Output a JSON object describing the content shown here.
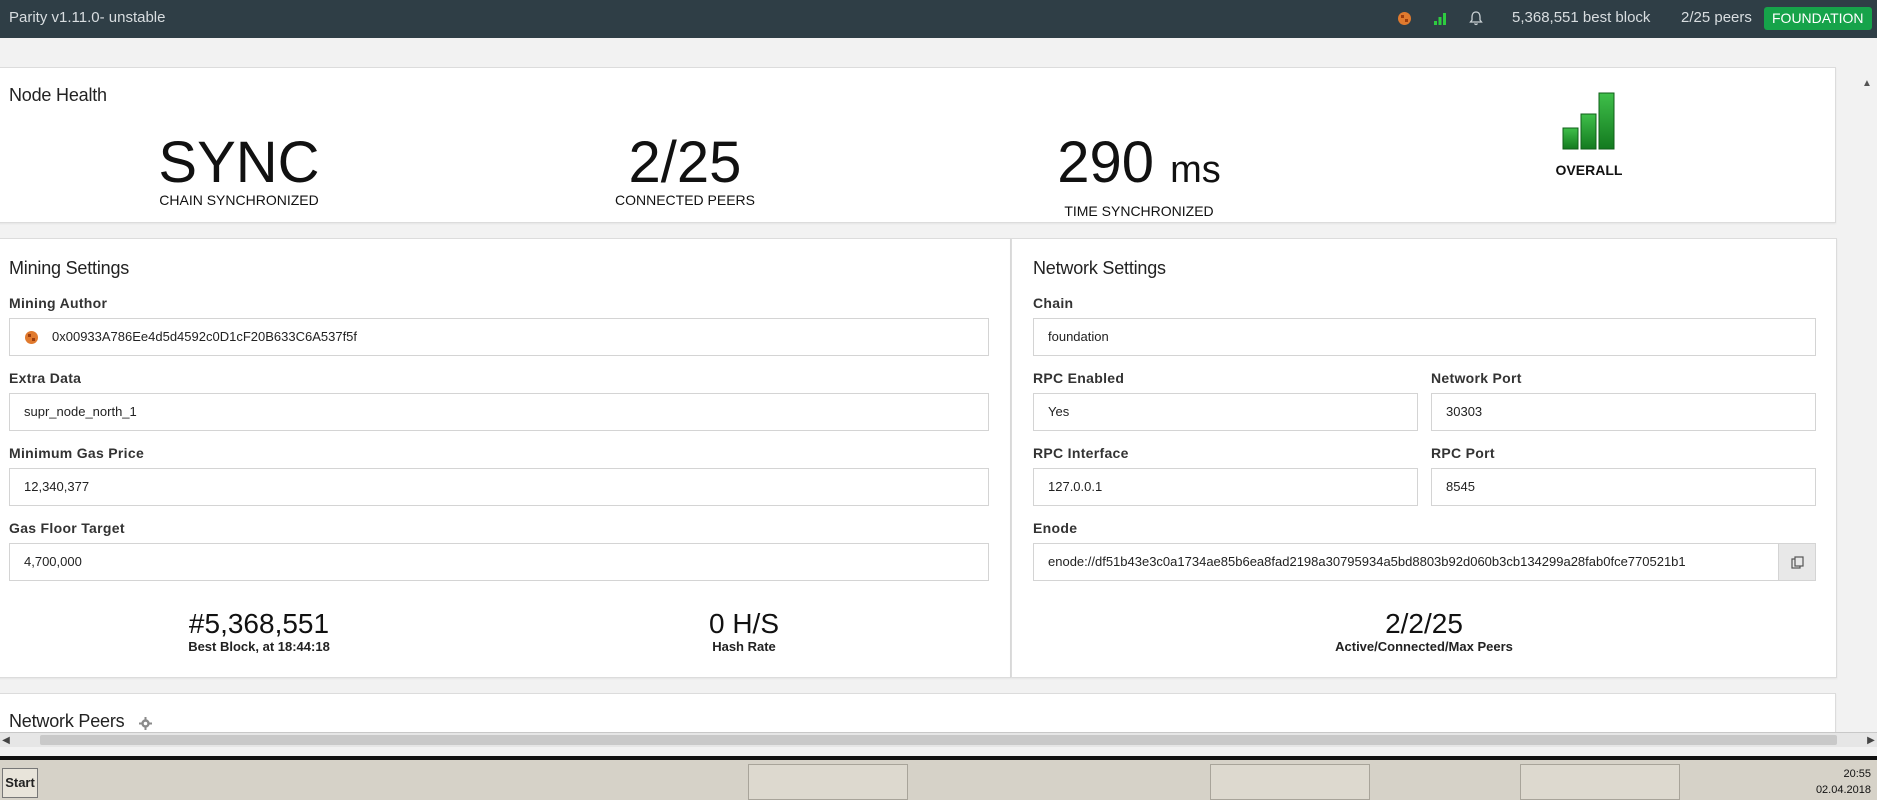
{
  "topbar": {
    "title": "Parity v1.11.0- unstable",
    "best_block": "5,368,551 best block",
    "peers": "2/25 peers",
    "chain_badge": "FOUNDATION",
    "icons": [
      "identicon",
      "signal-bars-icon",
      "bell-icon"
    ],
    "badge_color": "#16a34a"
  },
  "health": {
    "title": "Node Health",
    "sync_value": "SYNC",
    "sync_caption": "CHAIN SYNCHRONIZED",
    "peers_value": "2/25",
    "peers_caption": "CONNECTED PEERS",
    "time_value": "290",
    "time_unit": "ms",
    "time_caption": "TIME SYNCHRONIZED",
    "overall_caption": "OVERALL",
    "overall_color": "#1e9e2e"
  },
  "mining": {
    "title": "Mining Settings",
    "author_label": "Mining Author",
    "author_value": "0x00933A786Ee4d5d4592c0D1cF20B633C6A537f5f",
    "extra_label": "Extra Data",
    "extra_value": "supr_node_north_1",
    "gas_price_label": "Minimum Gas Price",
    "gas_price_value": "12,340,377",
    "gas_floor_label": "Gas Floor Target",
    "gas_floor_value": "4,700,000",
    "best_block_value": "#5,368,551",
    "best_block_label": "Best Block, at 18:44:18",
    "hash_rate_value": "0 H/S",
    "hash_rate_label": "Hash Rate"
  },
  "network": {
    "title": "Network Settings",
    "chain_label": "Chain",
    "chain_value": "foundation",
    "rpc_enabled_label": "RPC Enabled",
    "rpc_enabled_value": "Yes",
    "network_port_label": "Network Port",
    "network_port_value": "30303",
    "rpc_interface_label": "RPC Interface",
    "rpc_interface_value": "127.0.0.1",
    "rpc_port_label": "RPC Port",
    "rpc_port_value": "8545",
    "enode_label": "Enode",
    "enode_value": "enode://df51b43e3c0a1734ae85b6ea8fad2198a30795934a5bd8803b92d060b3cb134299a28fab0fce770521b1",
    "peers_value": "2/2/25",
    "peers_label": "Active/Connected/Max Peers"
  },
  "peers_section": {
    "title": "Network Peers"
  },
  "taskbar": {
    "start_label": "Start",
    "time": "20:55",
    "date": "02.04.2018"
  }
}
